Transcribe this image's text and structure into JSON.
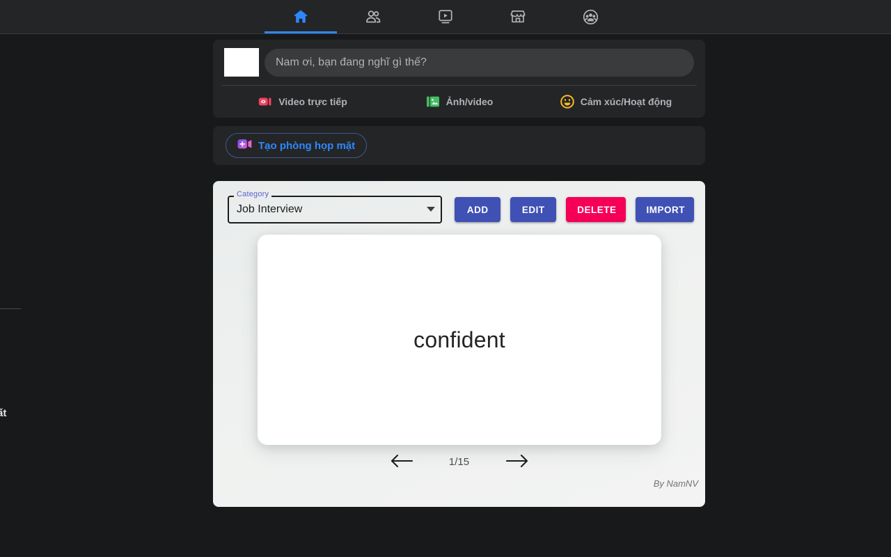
{
  "colors": {
    "page_bg": "#18191a",
    "surface": "#242526",
    "input_bg": "#3a3b3c",
    "accent_blue": "#2d88ff",
    "text_primary": "#e4e6eb",
    "text_secondary": "#b0b3b8",
    "app_bg": "#eff1f0",
    "btn_primary": "#3f51b5",
    "btn_danger": "#f50057",
    "live_red": "#f3425f",
    "photo_green": "#45bd62",
    "feeling_yellow": "#f7b928"
  },
  "topnav": {
    "tabs": [
      {
        "icon": "home-icon",
        "name": "tab-home",
        "active": true
      },
      {
        "icon": "friends-icon",
        "name": "tab-friends",
        "active": false
      },
      {
        "icon": "watch-icon",
        "name": "tab-watch",
        "active": false
      },
      {
        "icon": "marketplace-icon",
        "name": "tab-marketplace",
        "active": false
      },
      {
        "icon": "groups-icon",
        "name": "tab-groups",
        "active": false
      }
    ]
  },
  "composer": {
    "placeholder": "Nam ơi, bạn đang nghĩ gì thế?",
    "value": "",
    "actions": [
      {
        "label": "Video trực tiếp",
        "icon": "live-video-icon",
        "color": "#f3425f"
      },
      {
        "label": "Ảnh/video",
        "icon": "photo-video-icon",
        "color": "#45bd62"
      },
      {
        "label": "Cảm xúc/Hoạt động",
        "icon": "feeling-activity-icon",
        "color": "#f7b928"
      }
    ]
  },
  "rooms": {
    "create_label": "Tạo phòng họp mặt",
    "icon": "create-room-video-icon"
  },
  "flashcards": {
    "category_label": "Category",
    "category_value": "Job Interview",
    "buttons": [
      {
        "label": "ADD",
        "style": "primary",
        "name": "add-button"
      },
      {
        "label": "EDIT",
        "style": "primary",
        "name": "edit-button"
      },
      {
        "label": "DELETE",
        "style": "danger",
        "name": "delete-button"
      },
      {
        "label": "IMPORT",
        "style": "primary",
        "name": "import-button"
      }
    ],
    "card_term": "confident",
    "pager": {
      "prev_icon": "arrow-left-icon",
      "next_icon": "arrow-right-icon",
      "count": "1/15",
      "current": 1,
      "total": 15
    },
    "credit": "By NamNV"
  },
  "background_artifacts": {
    "clipped_text": "ất"
  }
}
